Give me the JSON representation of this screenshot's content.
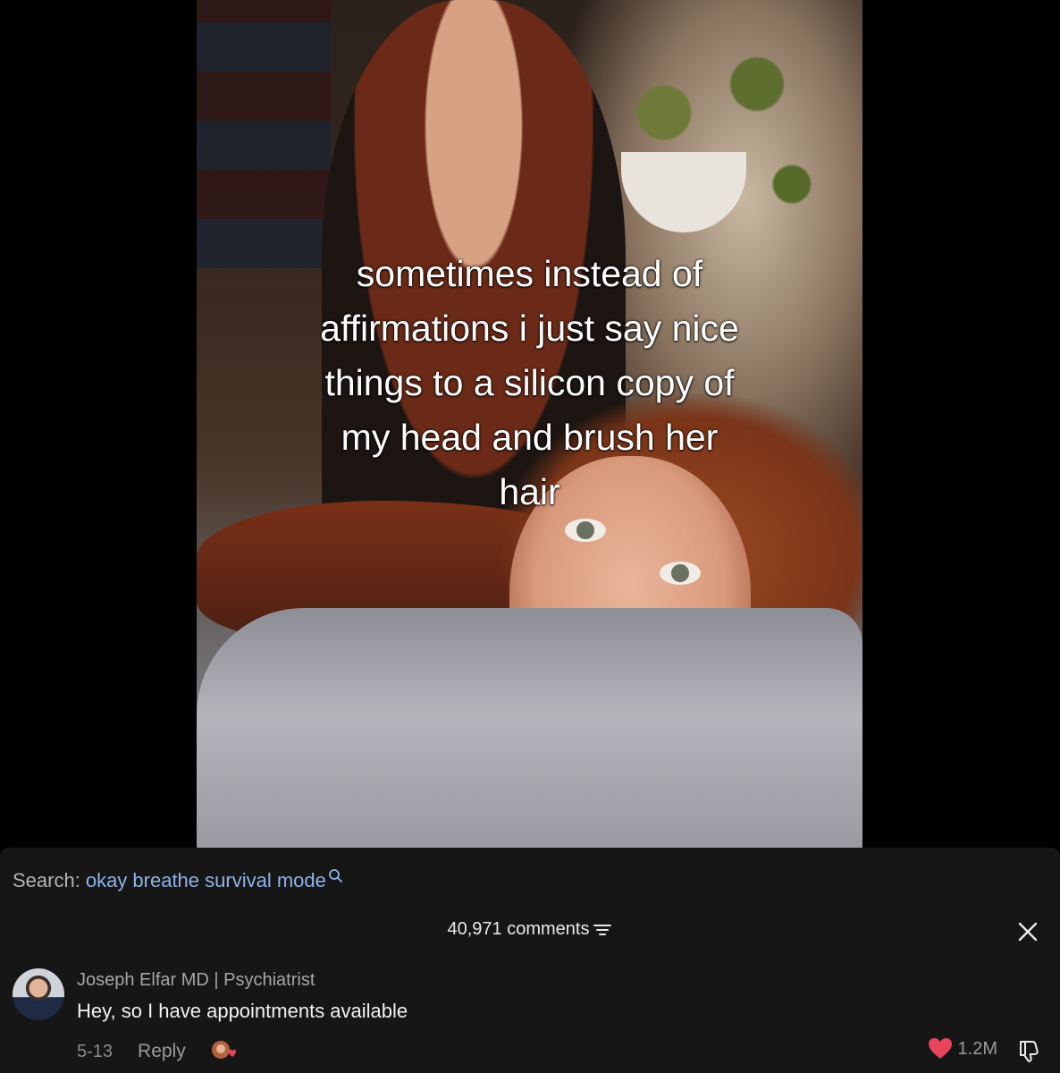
{
  "video": {
    "caption": "sometimes instead of\naffirmations i just say nice\nthings to a silicon copy of\nmy head and brush her\nhair"
  },
  "search": {
    "prefix": "Search:",
    "query": "okay breathe survival mode",
    "icon": "search-icon"
  },
  "comments": {
    "count_label": "40,971 comments",
    "items": [
      {
        "author": "Joseph Elfar MD | Psychiatrist",
        "text": "Hey, so I have appointments available",
        "date": "5-13",
        "reply_label": "Reply",
        "likes": "1.2M"
      }
    ]
  },
  "colors": {
    "panel_bg": "#161616",
    "search_query": "#8fb3ea",
    "like_heart": "#e8455d"
  }
}
